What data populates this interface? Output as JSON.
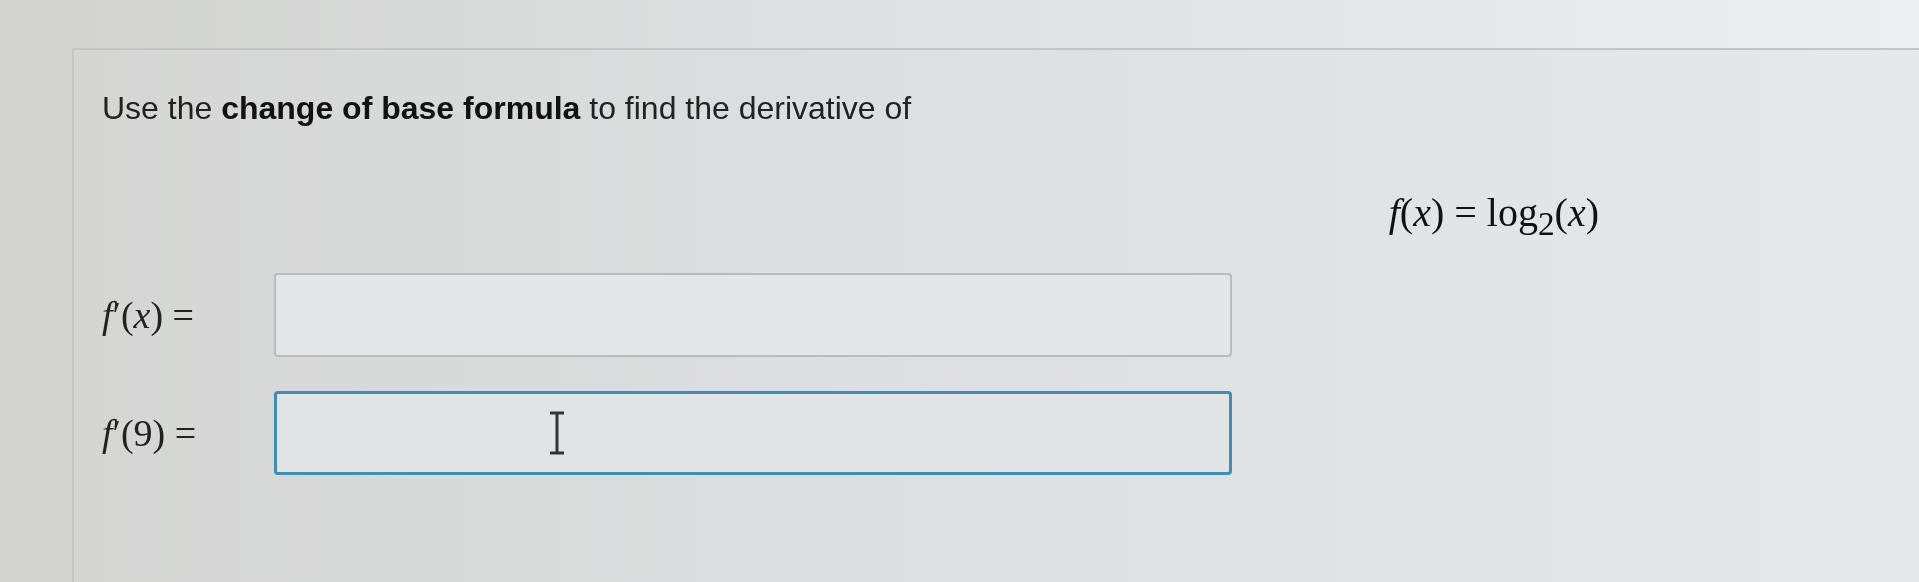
{
  "question": {
    "prompt": "Use the **change of base formula** to find the derivative of",
    "formula": "*f*(*x*) = log$_{2}$(*x*)",
    "answers": [
      {
        "label": "*f*′(*x*) =",
        "focused": false
      },
      {
        "label": "*f*′(9) =",
        "focused": true
      }
    ]
  }
}
